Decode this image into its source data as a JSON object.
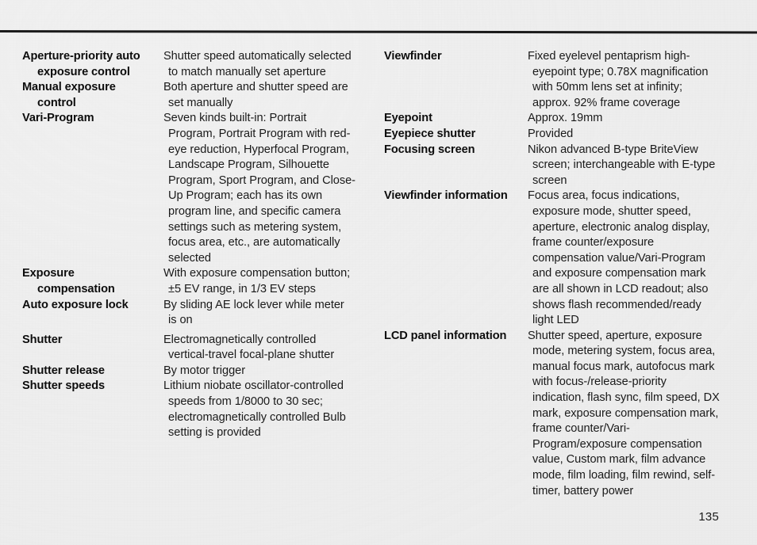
{
  "document": {
    "page_number": "135",
    "rule_color": "#1b1b1b",
    "background_color": "#f0f0f0",
    "text_color": "#1a1a1a"
  },
  "columns": {
    "left": [
      {
        "term_lines": [
          "Aperture-priority auto",
          "exposure control"
        ],
        "desc_lines": [
          "Shutter speed automatically selected",
          "to match manually set aperture"
        ],
        "gap_before": false
      },
      {
        "term_lines": [
          "Manual exposure",
          "control"
        ],
        "desc_lines": [
          "Both aperture and shutter speed are",
          "set manually"
        ],
        "gap_before": false
      },
      {
        "term_lines": [
          "Vari-Program"
        ],
        "desc_lines": [
          "Seven kinds built-in: Portrait",
          "Program, Portrait Program with red-",
          "eye reduction, Hyperfocal Program,",
          "Landscape Program, Silhouette",
          "Program, Sport Program, and Close-",
          "Up Program; each has its own",
          "program line, and specific camera",
          "settings such as metering system,",
          "focus area, etc., are automatically",
          "selected"
        ],
        "gap_before": false
      },
      {
        "term_lines": [
          "Exposure",
          "compensation"
        ],
        "desc_lines": [
          "With exposure compensation button;",
          "±5 EV range, in 1/3 EV steps"
        ],
        "gap_before": false
      },
      {
        "term_lines": [
          "Auto exposure lock"
        ],
        "desc_lines": [
          "By sliding AE lock lever while meter",
          "is on"
        ],
        "gap_before": false
      },
      {
        "term_lines": [
          "Shutter"
        ],
        "desc_lines": [
          "Electromagnetically controlled",
          "vertical-travel focal-plane shutter"
        ],
        "gap_before": true
      },
      {
        "term_lines": [
          "Shutter release"
        ],
        "desc_lines": [
          "By motor trigger"
        ],
        "gap_before": false
      },
      {
        "term_lines": [
          "Shutter speeds"
        ],
        "desc_lines": [
          "Lithium niobate oscillator-controlled",
          "speeds from 1/8000 to 30 sec;",
          "electromagnetically controlled Bulb",
          "setting is provided"
        ],
        "gap_before": false
      }
    ],
    "right": [
      {
        "term_lines": [
          "Viewfinder"
        ],
        "desc_lines": [
          "Fixed eyelevel pentaprism high-",
          "eyepoint type; 0.78X magnification",
          "with 50mm lens set at infinity;",
          "approx. 92% frame coverage"
        ],
        "gap_before": false
      },
      {
        "term_lines": [
          "Eyepoint"
        ],
        "desc_lines": [
          "Approx. 19mm"
        ],
        "gap_before": false
      },
      {
        "term_lines": [
          "Eyepiece shutter"
        ],
        "desc_lines": [
          "Provided"
        ],
        "gap_before": false
      },
      {
        "term_lines": [
          "Focusing screen"
        ],
        "desc_lines": [
          "Nikon advanced B-type BriteView",
          "screen; interchangeable with E-type",
          "screen"
        ],
        "gap_before": false
      },
      {
        "term_lines": [
          "Viewfinder information"
        ],
        "desc_lines": [
          "Focus area, focus indications,",
          "exposure mode, shutter speed,",
          "aperture, electronic analog display,",
          "frame counter/exposure",
          "compensation value/Vari-Program",
          "and exposure compensation mark",
          "are all shown in LCD readout; also",
          "shows flash recommended/ready",
          "light LED"
        ],
        "gap_before": false
      },
      {
        "term_lines": [
          "LCD panel information"
        ],
        "desc_lines": [
          "Shutter speed, aperture, exposure",
          "mode, metering system, focus area,",
          "manual focus mark, autofocus mark",
          "with focus-/release-priority",
          "indication, flash sync, film speed, DX",
          "mark, exposure compensation mark,",
          "frame counter/Vari-",
          "Program/exposure compensation",
          "value, Custom mark, film advance",
          "mode, film loading, film rewind, self-",
          "timer, battery power"
        ],
        "gap_before": false
      }
    ]
  }
}
